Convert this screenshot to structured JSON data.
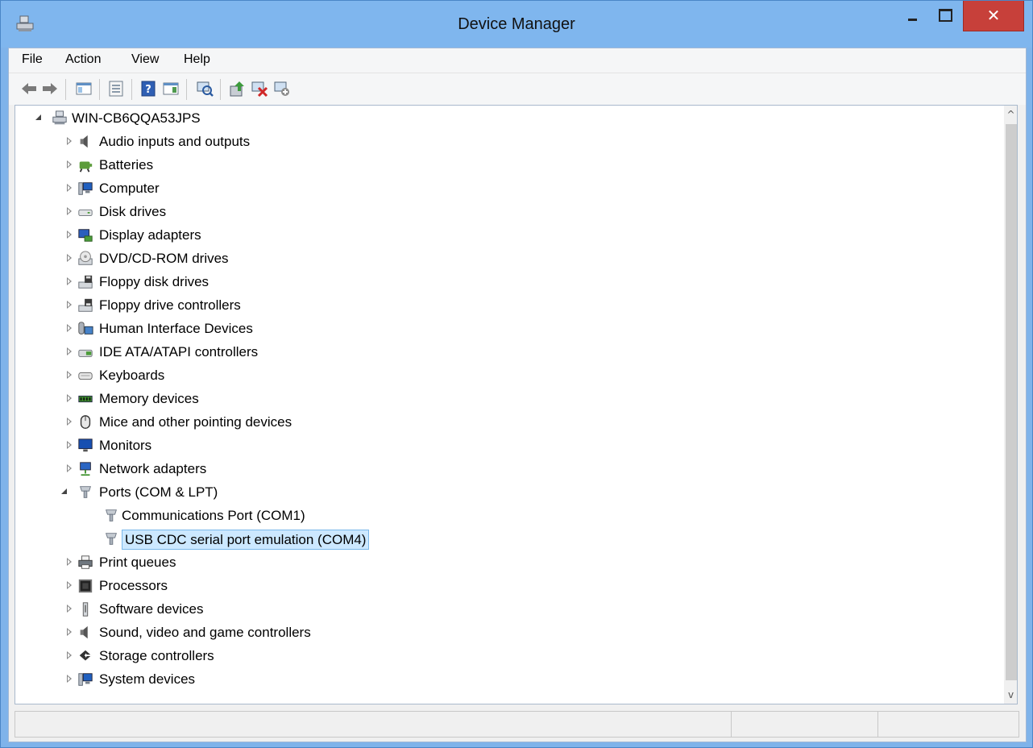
{
  "window": {
    "title": "Device Manager",
    "close_glyph": "✕"
  },
  "menu": {
    "file": "File",
    "action": "Action",
    "view": "View",
    "help": "Help"
  },
  "tree": {
    "root": "WIN-CB6QQA53JPS",
    "categories": [
      {
        "label": "Audio inputs and outputs",
        "icon": "speaker-icon"
      },
      {
        "label": "Batteries",
        "icon": "battery-icon"
      },
      {
        "label": "Computer",
        "icon": "computer-icon"
      },
      {
        "label": "Disk drives",
        "icon": "disk-drive-icon"
      },
      {
        "label": "Display adapters",
        "icon": "display-adapter-icon"
      },
      {
        "label": "DVD/CD-ROM drives",
        "icon": "dvd-drive-icon"
      },
      {
        "label": "Floppy disk drives",
        "icon": "floppy-disk-icon"
      },
      {
        "label": "Floppy drive controllers",
        "icon": "floppy-controller-icon"
      },
      {
        "label": "Human Interface Devices",
        "icon": "hid-icon"
      },
      {
        "label": "IDE ATA/ATAPI controllers",
        "icon": "ide-controller-icon"
      },
      {
        "label": "Keyboards",
        "icon": "keyboard-icon"
      },
      {
        "label": "Memory devices",
        "icon": "memory-icon"
      },
      {
        "label": "Mice and other pointing devices",
        "icon": "mouse-icon"
      },
      {
        "label": "Monitors",
        "icon": "monitor-icon"
      },
      {
        "label": "Network adapters",
        "icon": "network-icon"
      },
      {
        "label": "Ports (COM & LPT)",
        "icon": "port-icon",
        "expanded": true
      },
      {
        "label": "Print queues",
        "icon": "printer-icon"
      },
      {
        "label": "Processors",
        "icon": "processor-icon"
      },
      {
        "label": "Software devices",
        "icon": "software-device-icon"
      },
      {
        "label": "Sound, video and game controllers",
        "icon": "sound-icon"
      },
      {
        "label": "Storage controllers",
        "icon": "storage-icon"
      },
      {
        "label": "System devices",
        "icon": "system-devices-icon"
      }
    ],
    "ports_children": [
      {
        "label": "Communications Port (COM1)",
        "icon": "port-icon"
      },
      {
        "label": "USB CDC serial port emulation (COM4)",
        "icon": "port-icon",
        "selected": true
      }
    ]
  },
  "scrollbar": {
    "up": "^",
    "down": "v"
  },
  "colors": {
    "title_bar": "#7fb6ee",
    "close_button": "#c7403a",
    "selection_bg": "#cce8ff",
    "selection_border": "#7ab8ea"
  }
}
